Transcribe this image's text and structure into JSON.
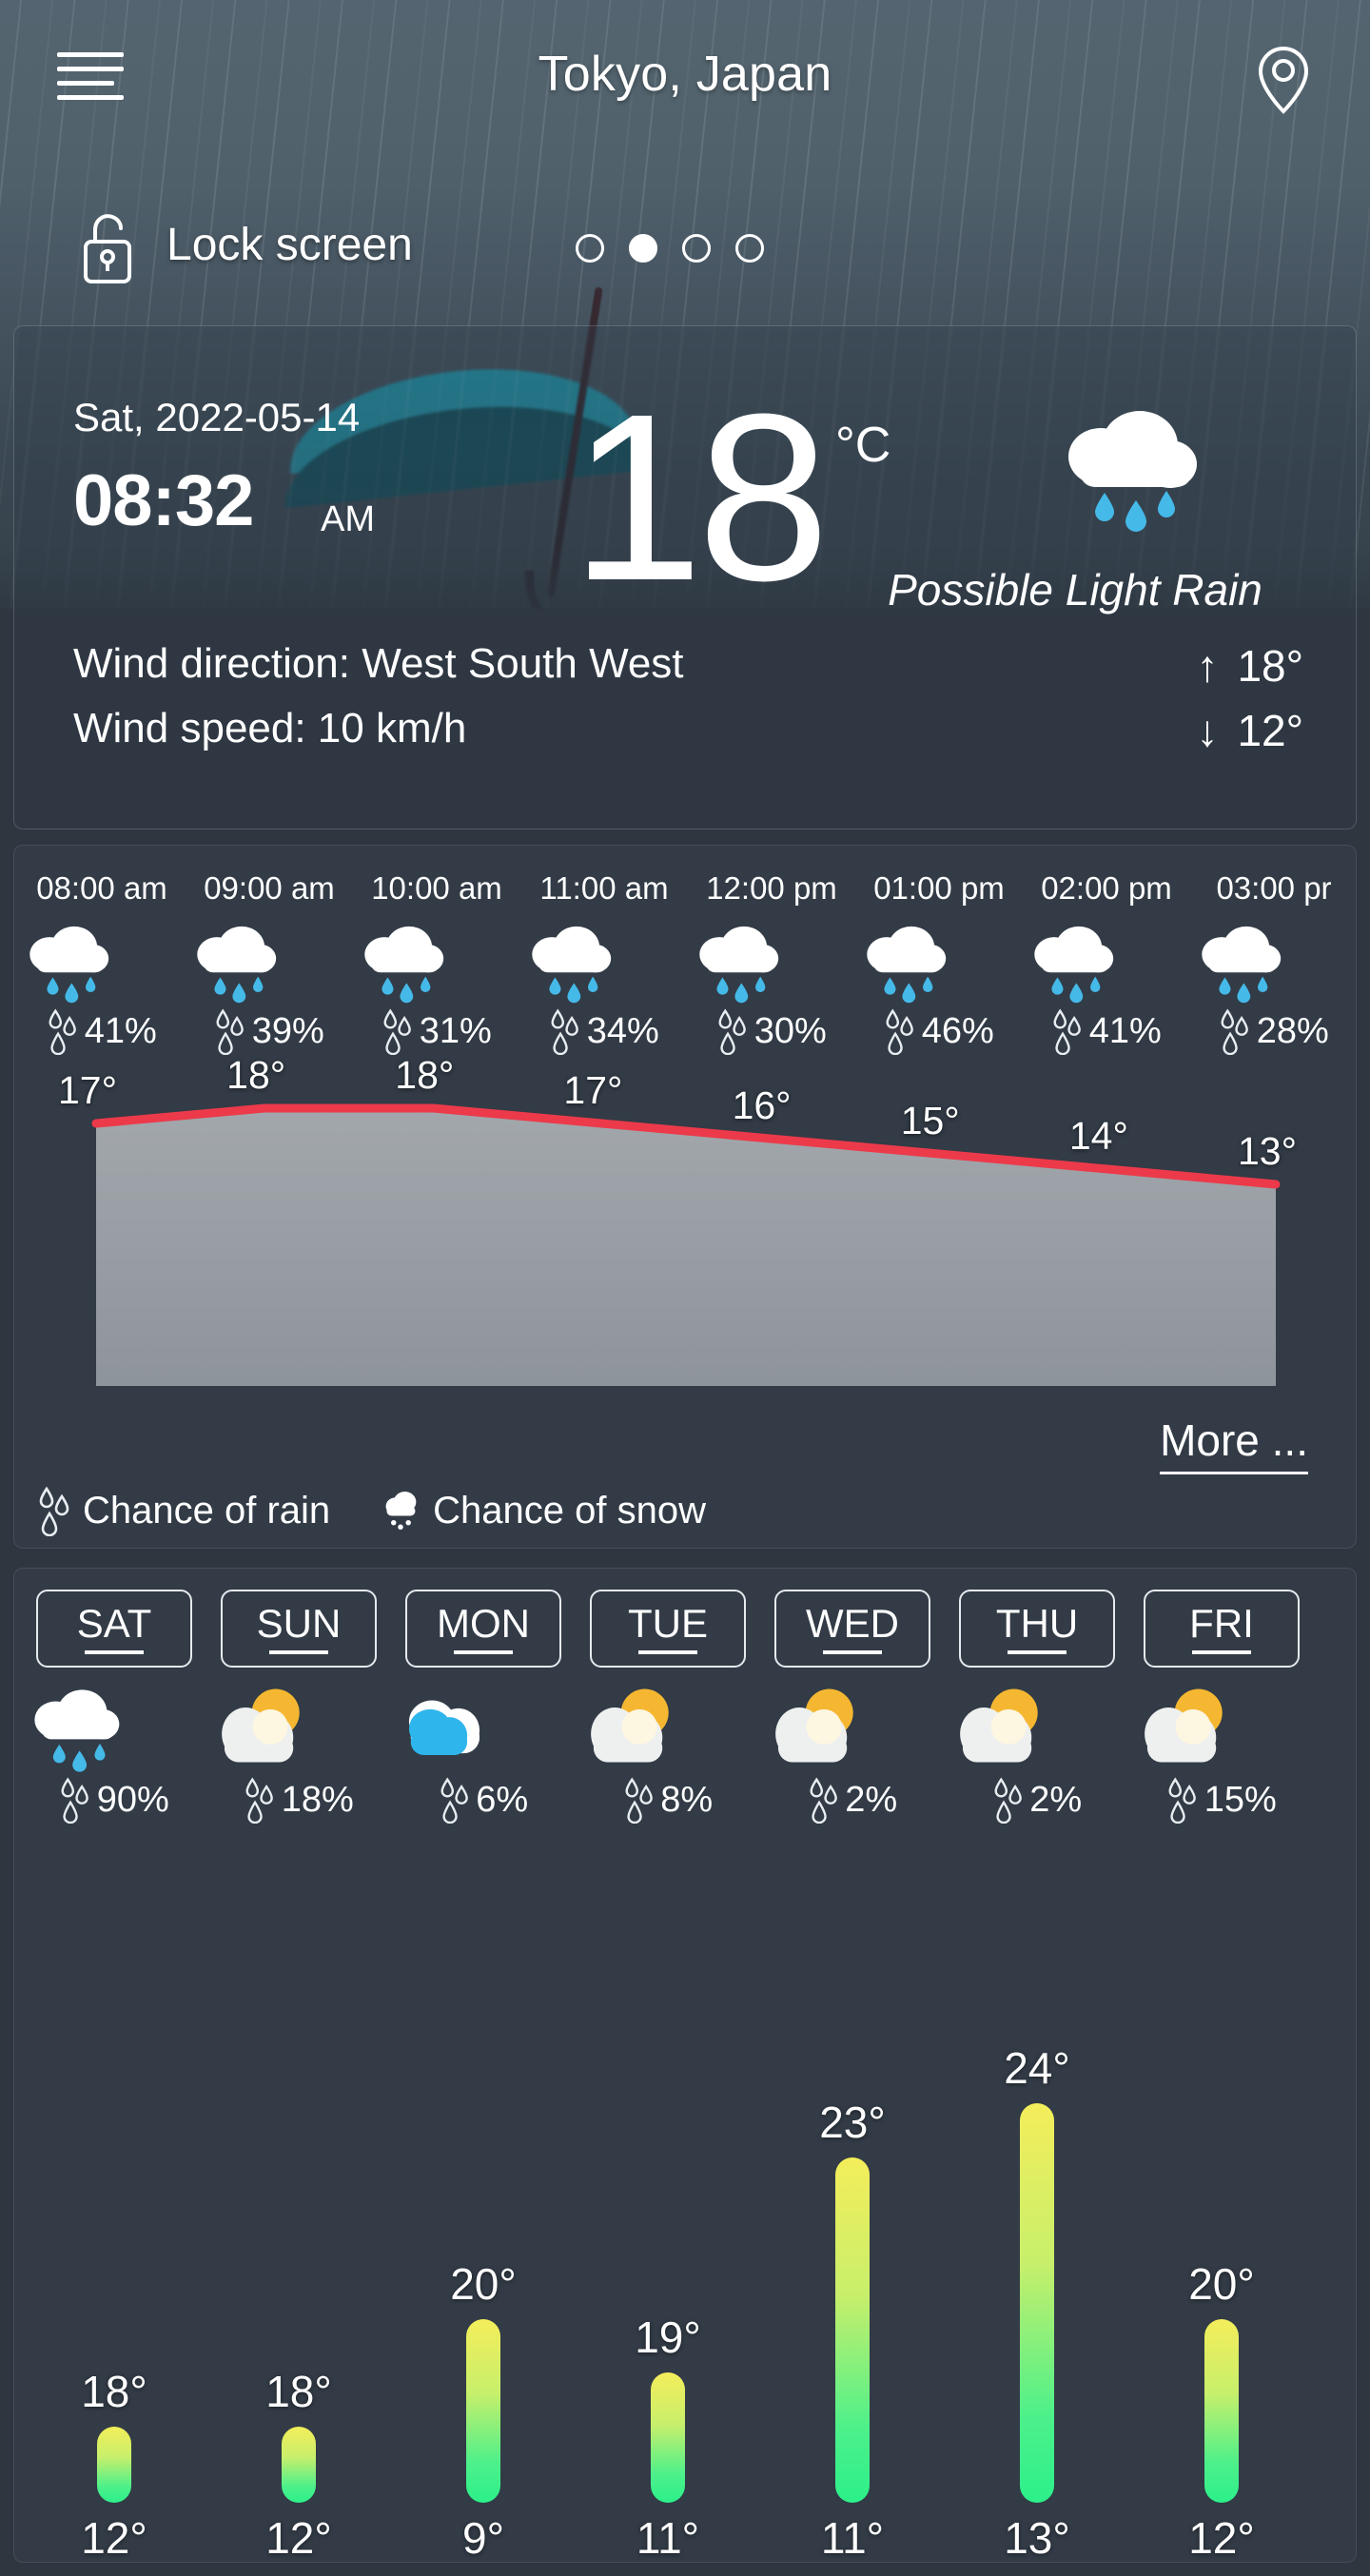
{
  "header": {
    "title": "Tokyo, Japan",
    "menu_icon": "hamburger-icon",
    "location_icon": "location-pin-icon"
  },
  "lock_row": {
    "label": "Lock screen",
    "lock_icon": "unlocked-padlock-icon",
    "pages": 4,
    "active_page": 2
  },
  "current": {
    "date": "Sat, 2022-05-14",
    "time": "08:32",
    "ampm": "AM",
    "temperature": "18",
    "unit": "°C",
    "condition": "Possible Light Rain",
    "condition_icon": "cloud-rain-icon",
    "wind_direction": "Wind direction: West South West",
    "wind_speed": "Wind speed: 10 km/h",
    "high": "18°",
    "low": "12°",
    "high_arrow": "↑",
    "low_arrow": "↓"
  },
  "hourly": {
    "more_label": "More ...",
    "legend_rain": "Chance of rain",
    "legend_snow": "Chance of snow",
    "legend_rain_icon": "raindrops-icon",
    "legend_snow_icon": "cloud-snow-icon",
    "items": [
      {
        "time": "08:00 am",
        "icon": "cloud-rain-icon",
        "pop": "41%",
        "temp": "17°"
      },
      {
        "time": "09:00 am",
        "icon": "cloud-rain-icon",
        "pop": "39%",
        "temp": "18°"
      },
      {
        "time": "10:00 am",
        "icon": "cloud-rain-icon",
        "pop": "31%",
        "temp": "18°"
      },
      {
        "time": "11:00 am",
        "icon": "cloud-rain-icon",
        "pop": "34%",
        "temp": "17°"
      },
      {
        "time": "12:00 pm",
        "icon": "cloud-rain-icon",
        "pop": "30%",
        "temp": "16°"
      },
      {
        "time": "01:00 pm",
        "icon": "cloud-rain-icon",
        "pop": "46%",
        "temp": "15°"
      },
      {
        "time": "02:00 pm",
        "icon": "cloud-rain-icon",
        "pop": "41%",
        "temp": "14°"
      },
      {
        "time": "03:00 pr",
        "icon": "cloud-rain-icon",
        "pop": "28%",
        "temp": "13°"
      }
    ]
  },
  "daily": {
    "items": [
      {
        "day": "SAT",
        "icon": "cloud-rain-icon",
        "pop": "90%",
        "high": "18°",
        "low": "12°"
      },
      {
        "day": "SUN",
        "icon": "sun-cloud-icon",
        "pop": "18%",
        "high": "18°",
        "low": "12°"
      },
      {
        "day": "MON",
        "icon": "blue-cloud-icon",
        "pop": "6%",
        "high": "20°",
        "low": "9°"
      },
      {
        "day": "TUE",
        "icon": "sun-cloud-icon",
        "pop": "8%",
        "high": "19°",
        "low": "11°"
      },
      {
        "day": "WED",
        "icon": "sun-cloud-icon",
        "pop": "2%",
        "high": "23°",
        "low": "11°"
      },
      {
        "day": "THU",
        "icon": "sun-cloud-icon",
        "pop": "2%",
        "high": "24°",
        "low": "13°"
      },
      {
        "day": "FRI",
        "icon": "sun-cloud-icon",
        "pop": "15%",
        "high": "20°",
        "low": "12°"
      }
    ]
  },
  "colors": {
    "card_bg": "#323b46",
    "page_bg": "#2e3640",
    "graph_line": "#ec3a4a",
    "graph_fill_top": "#a2a7ac",
    "graph_fill_bottom": "#8e949b",
    "bar_top": "#f4ee5a",
    "bar_bottom": "#2cf08a",
    "rain_drop": "#45b9e8",
    "sun": "#f5b731"
  },
  "chart_data": [
    {
      "type": "line",
      "title": "Hourly temperature",
      "x": [
        "08:00 am",
        "09:00 am",
        "10:00 am",
        "11:00 am",
        "12:00 pm",
        "01:00 pm",
        "02:00 pm",
        "03:00 pr"
      ],
      "values": [
        17,
        18,
        18,
        17,
        16,
        15,
        14,
        13
      ],
      "ylabel": "°C",
      "labels": [
        "17°",
        "18°",
        "18°",
        "17°",
        "16°",
        "15°",
        "14°",
        "13°"
      ],
      "line_color": "#ec3a4a",
      "area_fill": true,
      "grid": false,
      "legend": [
        "Chance of rain",
        "Chance of snow"
      ]
    },
    {
      "type": "bar",
      "title": "7 day forecast high temperature",
      "categories": [
        "SAT",
        "SUN",
        "MON",
        "TUE",
        "WED",
        "THU",
        "FRI"
      ],
      "values": [
        18,
        18,
        20,
        19,
        23,
        24,
        20
      ],
      "secondary_name": "low",
      "secondary_values": [
        12,
        12,
        9,
        11,
        11,
        13,
        12
      ],
      "ylabel": "°C",
      "ylim": [
        0,
        26
      ],
      "grid": false
    },
    {
      "type": "bar",
      "title": "Hourly chance of rain",
      "categories": [
        "08:00 am",
        "09:00 am",
        "10:00 am",
        "11:00 am",
        "12:00 pm",
        "01:00 pm",
        "02:00 pm",
        "03:00 pr"
      ],
      "values": [
        41,
        39,
        31,
        34,
        30,
        46,
        41,
        28
      ],
      "ylabel": "%"
    },
    {
      "type": "bar",
      "title": "Daily chance of rain",
      "categories": [
        "SAT",
        "SUN",
        "MON",
        "TUE",
        "WED",
        "THU",
        "FRI"
      ],
      "values": [
        90,
        18,
        6,
        8,
        2,
        2,
        15
      ],
      "ylabel": "%"
    }
  ]
}
